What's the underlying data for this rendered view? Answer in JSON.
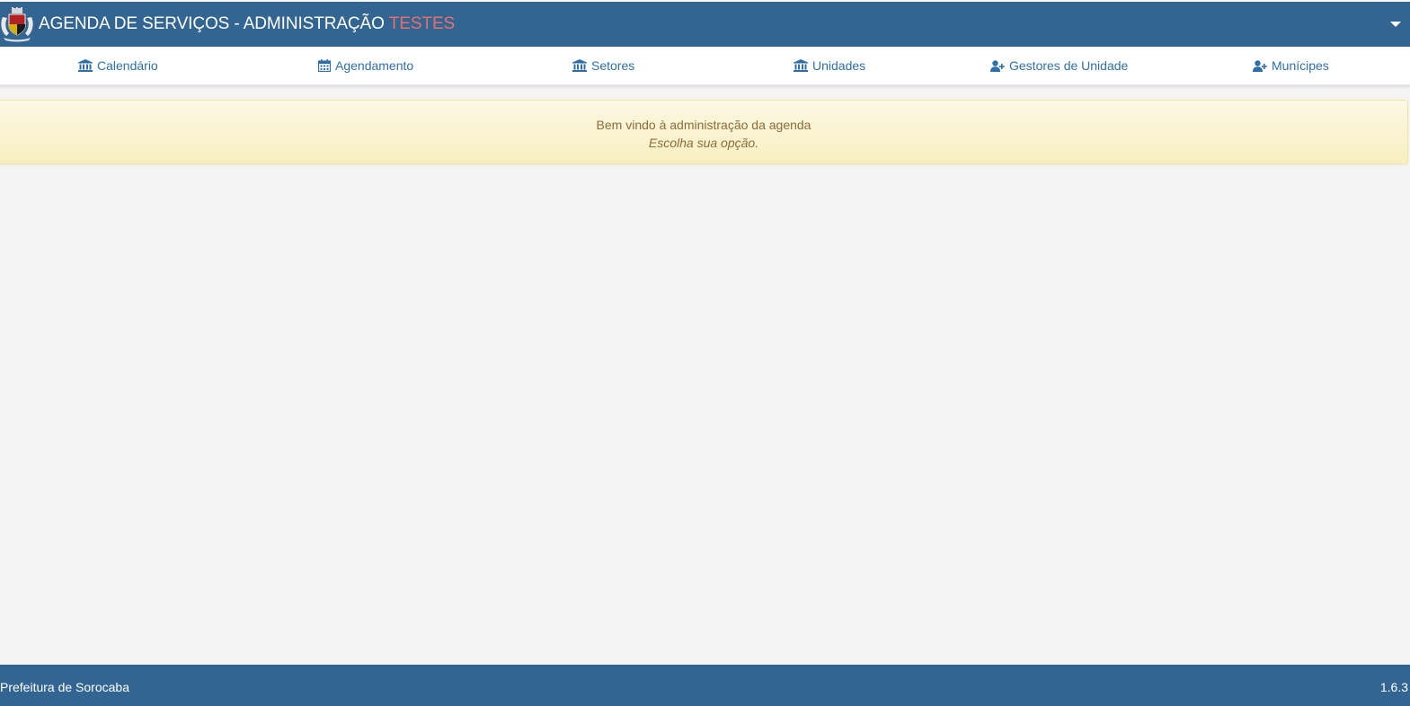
{
  "header": {
    "title": "AGENDA DE SERVIÇOS - ADMINISTRAÇÃO",
    "environment": "TESTES",
    "environment_color": "#e86f6f",
    "brand_color": "#326592",
    "logo": "sorocaba-coat-of-arms",
    "menu_icon": "caret-down-icon"
  },
  "nav": {
    "items": [
      {
        "label": "Calendário",
        "icon": "bank-icon"
      },
      {
        "label": "Agendamento",
        "icon": "calendar-icon"
      },
      {
        "label": "Setores",
        "icon": "bank-icon"
      },
      {
        "label": "Unidades",
        "icon": "bank-icon"
      },
      {
        "label": "Gestores de Unidade",
        "icon": "user-plus-icon"
      },
      {
        "label": "Munícipes",
        "icon": "user-plus-icon"
      }
    ]
  },
  "alert": {
    "message": "Bem vindo à administração da agenda",
    "hint": "Escolha sua opção."
  },
  "footer": {
    "organization": "Prefeitura de Sorocaba",
    "version": "1.6.3"
  }
}
